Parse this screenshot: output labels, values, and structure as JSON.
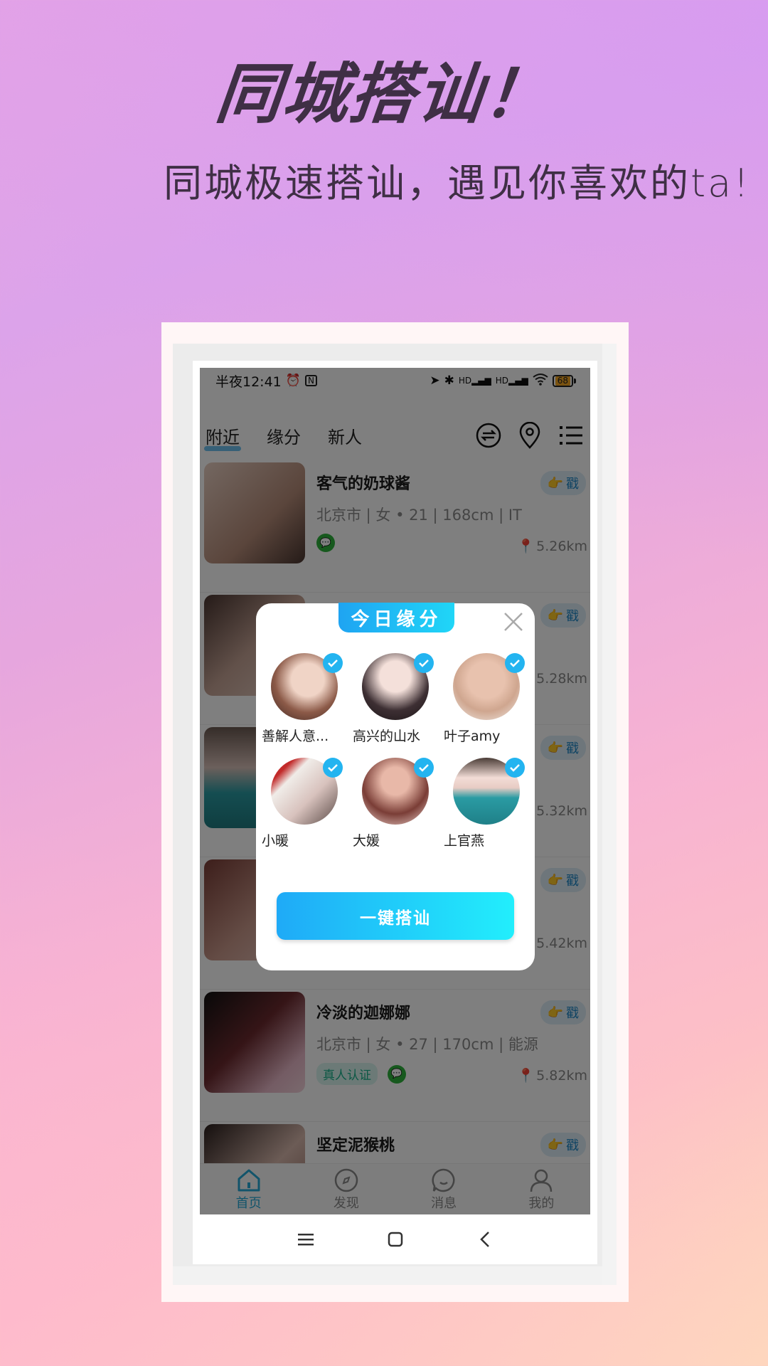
{
  "hero": {
    "title": "同城搭讪！",
    "subtitle": "同城极速搭讪，遇见你喜欢的ta!"
  },
  "status_bar": {
    "time": "半夜12:41",
    "battery": "68",
    "icons": [
      "alarm-icon",
      "nfc-icon",
      "location-arrow-icon",
      "bluetooth-icon",
      "signal-hd-icon",
      "signal-hd-icon",
      "wifi-icon",
      "battery-icon"
    ]
  },
  "top_nav": {
    "tabs": [
      {
        "label": "附近",
        "active": true
      },
      {
        "label": "缘分",
        "active": false
      },
      {
        "label": "新人",
        "active": false
      }
    ],
    "icons": [
      "filter-swap-icon",
      "location-pin-icon",
      "list-menu-icon"
    ]
  },
  "list": {
    "poke_label": "戳",
    "verified_label": "真人认证",
    "rows": [
      {
        "name": "客气的奶球酱",
        "meta": "北京市 | 女 • 21 | 168cm | IT",
        "distance": "5.26km",
        "verified": false,
        "wechat": true,
        "color": "#b58b78"
      },
      {
        "name": "",
        "meta": "",
        "distance": "5.28km",
        "verified": false,
        "wechat": false,
        "color": "#9a7466"
      },
      {
        "name": "",
        "meta": "",
        "distance": "5.32km",
        "verified": false,
        "wechat": false,
        "color": "#3f7a7c"
      },
      {
        "name": "",
        "meta": "",
        "distance": "5.42km",
        "verified": false,
        "wechat": false,
        "color": "#8a5f5f"
      },
      {
        "name": "冷淡的迦娜娜",
        "meta": "北京市 | 女 • 27 | 170cm | 能源",
        "distance": "5.82km",
        "verified": true,
        "wechat": true,
        "color": "#6b2a2e"
      },
      {
        "name": "坚定泥猴桃",
        "meta": "",
        "distance": "",
        "verified": false,
        "wechat": false,
        "color": "#6e4a44"
      }
    ]
  },
  "bottom_nav": [
    {
      "label": "首页",
      "icon": "home-icon",
      "active": true
    },
    {
      "label": "发现",
      "icon": "compass-icon",
      "active": false
    },
    {
      "label": "消息",
      "icon": "chat-bubble-icon",
      "active": false
    },
    {
      "label": "我的",
      "icon": "profile-icon",
      "active": false
    }
  ],
  "modal": {
    "title": "今日缘分",
    "button_label": "一键搭讪",
    "matches": [
      {
        "name": "善解人意...",
        "checked": true,
        "color": "#8c5a48"
      },
      {
        "name": "高兴的山水",
        "checked": true,
        "color": "#3d2f33"
      },
      {
        "name": "叶子amy",
        "checked": true,
        "color": "#cfa68f"
      },
      {
        "name": "小暖",
        "checked": true,
        "color": "#d8c2bd"
      },
      {
        "name": "大媛",
        "checked": true,
        "color": "#7a3d36"
      },
      {
        "name": "上官燕",
        "checked": true,
        "color": "#2a9ba3"
      }
    ]
  },
  "colors": {
    "accent": "#23b4f0",
    "title_text": "#3f2f45",
    "wechat_green": "#2fb33c"
  }
}
